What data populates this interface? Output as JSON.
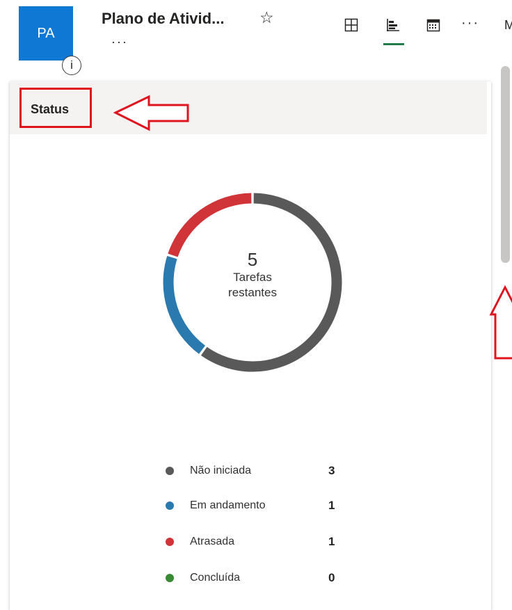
{
  "plan": {
    "avatar_initials": "PA",
    "info_icon": "i",
    "title": "Plano de Ativid...",
    "star_icon": "☆",
    "title_more": "···",
    "views": [
      {
        "icon": "grid-icon"
      },
      {
        "icon": "chart-icon",
        "active": true
      },
      {
        "icon": "calendar-icon"
      }
    ],
    "header_more": "···",
    "cut_text": "M"
  },
  "card": {
    "title": "Status",
    "remaining_count": "5",
    "remaining_label_line1": "Tarefas",
    "remaining_label_line2": "restantes"
  },
  "colors": {
    "not_started": "#595959",
    "in_progress": "#2a7ab0",
    "late": "#d13438",
    "completed": "#388a34",
    "annotation": "#e0141e",
    "accent": "#237b4b"
  },
  "chart_data": {
    "type": "pie",
    "categories": [
      "Não iniciada",
      "Em andamento",
      "Atrasada",
      "Concluída"
    ],
    "values": [
      3,
      1,
      1,
      0
    ],
    "center_value": 5,
    "center_label": "Tarefas restantes"
  },
  "legend": [
    {
      "label": "Não iniciada",
      "value": "3"
    },
    {
      "label": "Em andamento",
      "value": "1"
    },
    {
      "label": "Atrasada",
      "value": "1"
    },
    {
      "label": "Concluída",
      "value": "0"
    }
  ]
}
